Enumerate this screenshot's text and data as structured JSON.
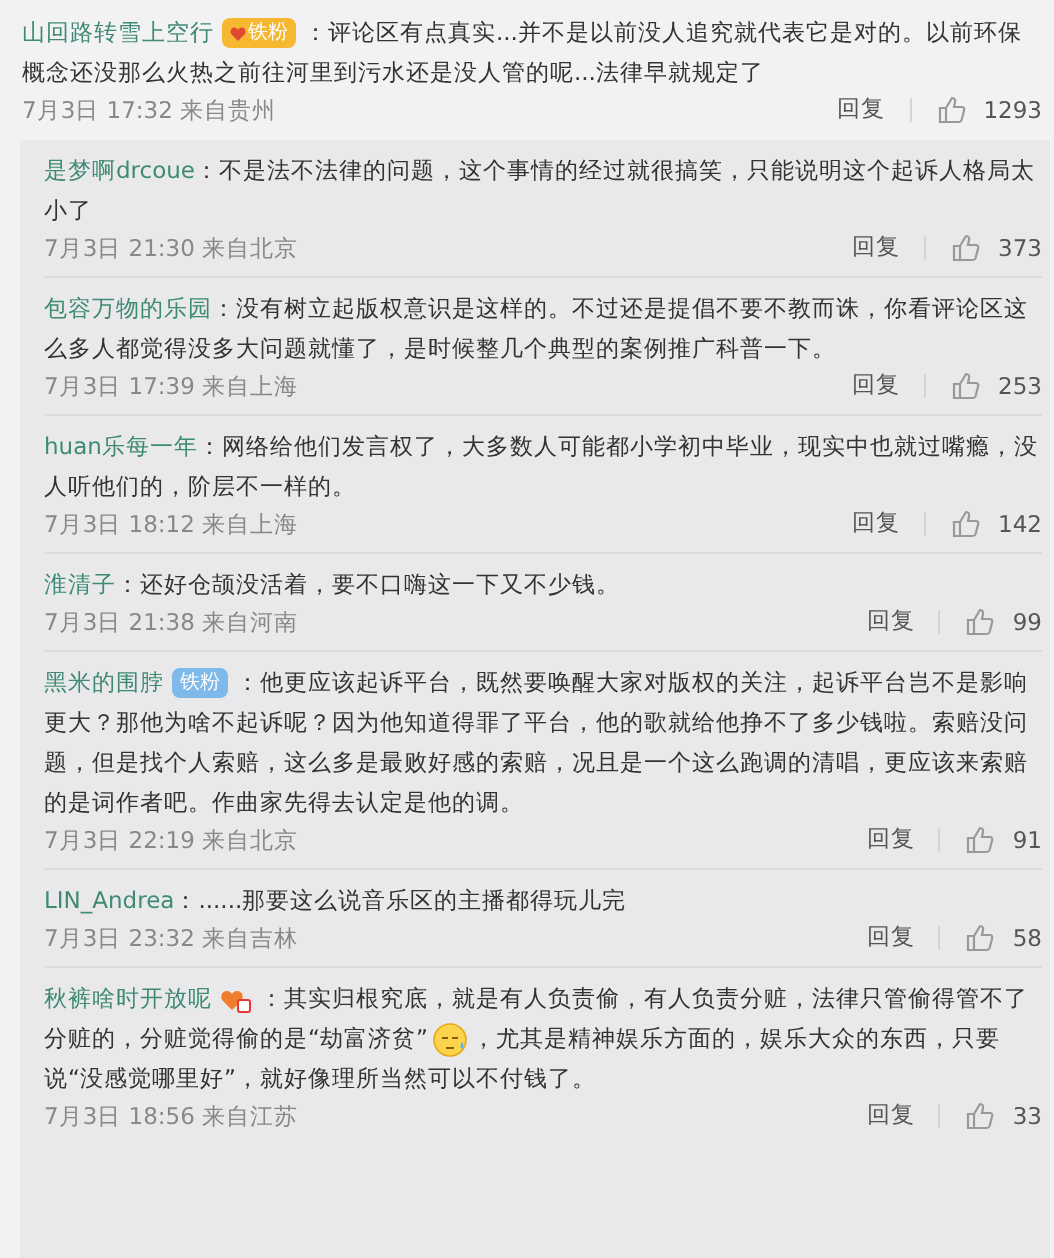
{
  "top_comment": {
    "user": "山回路转雪上空行",
    "badge": {
      "kind": "fan-orange",
      "label": "铁粉"
    },
    "parts": [
      {
        "kind": "text",
        "text": "：评论区有点真实...并不是以前没人追究就代表它是对的。以前环保概念还没那么火热之前往河里到污水还是没人管的呢...法律早就规定了"
      }
    ],
    "time": "7月3日 17:32 来自贵州",
    "reply_label": "回复",
    "likes": "1293"
  },
  "replies": [
    {
      "user": "是梦啊drcoue",
      "parts": [
        {
          "kind": "text",
          "text": "：不是法不法律的问题，这个事情的经过就很搞笑，只能说明这个起诉人格局太小了"
        }
      ],
      "time": "7月3日 21:30 来自北京",
      "reply_label": "回复",
      "likes": "373"
    },
    {
      "user": "包容万物的乐园",
      "parts": [
        {
          "kind": "text",
          "text": "：没有树立起版权意识是这样的。不过还是提倡不要不教而诛，你看评论区这么多人都觉得没多大问题就懂了，是时候整几个典型的案例推广科普一下。"
        }
      ],
      "time": "7月3日 17:39 来自上海",
      "reply_label": "回复",
      "likes": "253"
    },
    {
      "user": "huan乐每一年",
      "parts": [
        {
          "kind": "text",
          "text": "：网络给他们发言权了，大多数人可能都小学初中毕业，现实中也就过嘴瘾，没人听他们的，阶层不一样的。"
        }
      ],
      "time": "7月3日 18:12 来自上海",
      "reply_label": "回复",
      "likes": "142"
    },
    {
      "user": "淮清子",
      "parts": [
        {
          "kind": "text",
          "text": "：还好仓颉没活着，要不口嗨这一下又不少钱。"
        }
      ],
      "time": "7月3日 21:38 来自河南",
      "reply_label": "回复",
      "likes": "99"
    },
    {
      "user": "黑米的围脖",
      "badge": {
        "kind": "fan-blue",
        "label": "铁粉"
      },
      "parts": [
        {
          "kind": "text",
          "text": "：他更应该起诉平台，既然要唤醒大家对版权的关注，起诉平台岂不是影响更大？那他为啥不起诉呢？因为他知道得罪了平台，他的歌就给他挣不了多少钱啦。索赔没问题，但是找个人索赔，这么多是最败好感的索赔，况且是一个这么跑调的清唱，更应该来索赔的是词作者吧。作曲家先得去认定是他的调。"
        }
      ],
      "time": "7月3日 22:19 来自北京",
      "reply_label": "回复",
      "likes": "91"
    },
    {
      "user": "LIN_Andrea",
      "parts": [
        {
          "kind": "text",
          "text": "：......那要这么说音乐区的主播都得玩儿完"
        }
      ],
      "time": "7月3日 23:32 来自吉林",
      "reply_label": "回复",
      "likes": "58"
    },
    {
      "user": "秋裤啥时开放呢",
      "badge": {
        "kind": "vip-icon"
      },
      "parts": [
        {
          "kind": "text",
          "text": "：其实归根究底，就是有人负责偷，有人负责分赃，法律只管偷得管不了分赃的，分赃觉得偷的是“劫富济贫”"
        },
        {
          "kind": "emoji"
        },
        {
          "kind": "text",
          "text": "，尤其是精神娱乐方面的，娱乐大众的东西，只要说“没感觉哪里好”，就好像理所当然可以不付钱了。"
        }
      ],
      "time": "7月3日 18:56 来自江苏",
      "reply_label": "回复",
      "likes": "33"
    }
  ]
}
